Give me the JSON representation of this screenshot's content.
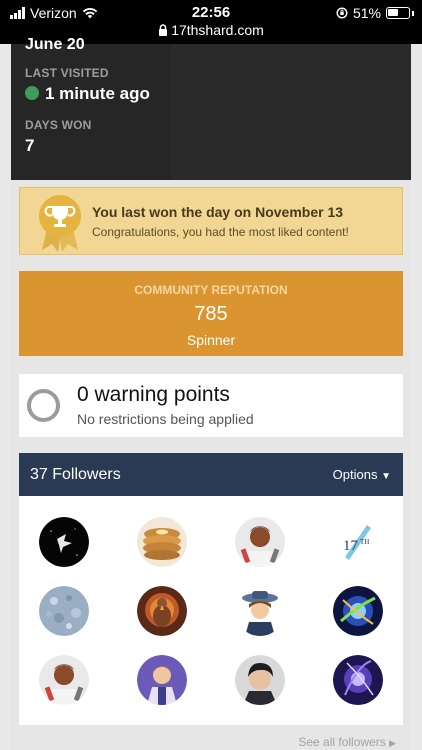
{
  "status_bar": {
    "carrier": "Verizon",
    "time": "22:56",
    "url": "17thshard.com",
    "battery": "51%",
    "icons": [
      "signal-icon",
      "wifi-icon",
      "lock-icon",
      "orientation-lock-icon",
      "battery-icon"
    ]
  },
  "profile": {
    "clipped_text": "June 20",
    "last_visited_label": "LAST VISITED",
    "last_visited_value": "1 minute ago",
    "days_won_label": "DAYS WON",
    "days_won_value": "7"
  },
  "won": {
    "title": "You last won the day on November 13",
    "subtitle": "Congratulations, you had the most liked content!",
    "icon": "trophy-ribbon-icon"
  },
  "reputation": {
    "label": "COMMUNITY REPUTATION",
    "value": "785",
    "rank": "Spinner"
  },
  "warnings": {
    "title": "0 warning points",
    "subtitle": "No restrictions being applied"
  },
  "followers": {
    "title": "37 Followers",
    "options_label": "Options",
    "see_all_label": "See all followers",
    "avatars": [
      "avatar-dark-spren",
      "avatar-pancakes",
      "avatar-bearded-man",
      "avatar-17th-logo",
      "avatar-blue-texture",
      "avatar-turkey",
      "avatar-character-hat",
      "avatar-blue-flare",
      "avatar-bearded-man-2",
      "avatar-man-purple",
      "avatar-dark-hair-man",
      "avatar-purple-flare"
    ]
  },
  "colors": {
    "dark_panel": "#262626",
    "won_bg": "#f1d793",
    "reputation_bg": "#da9430",
    "followers_header": "#2a3a55"
  }
}
